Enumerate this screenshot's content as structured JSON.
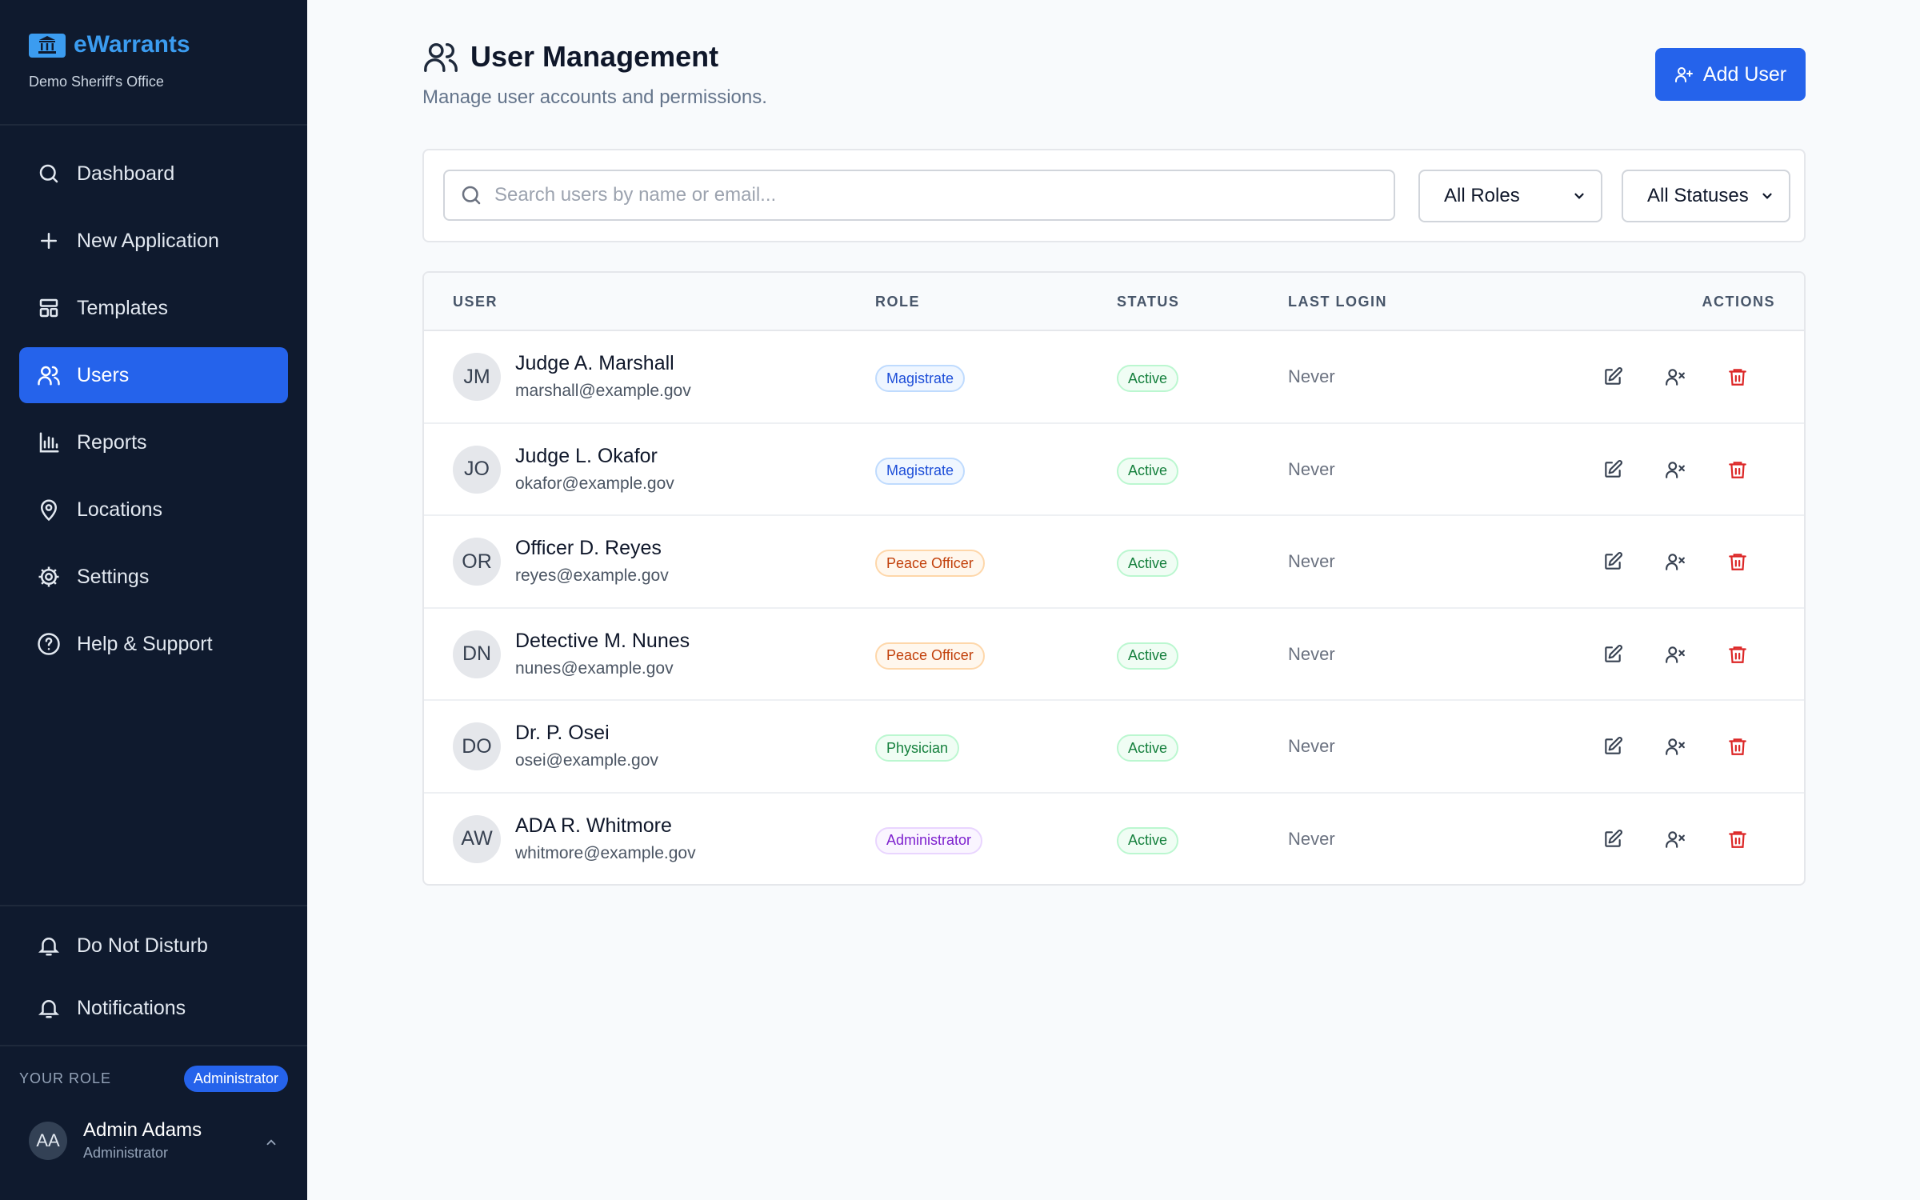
{
  "brand": {
    "name": "eWarrants",
    "org": "Demo Sheriff's Office"
  },
  "nav": [
    {
      "label": "Dashboard",
      "icon": "search-icon"
    },
    {
      "label": "New Application",
      "icon": "plus-icon"
    },
    {
      "label": "Templates",
      "icon": "layout-icon"
    },
    {
      "label": "Users",
      "icon": "users-icon",
      "active": true
    },
    {
      "label": "Reports",
      "icon": "bar-chart-icon"
    },
    {
      "label": "Locations",
      "icon": "map-pin-icon"
    },
    {
      "label": "Settings",
      "icon": "gear-icon"
    },
    {
      "label": "Help & Support",
      "icon": "help-circle-icon"
    }
  ],
  "bottom_nav": [
    {
      "label": "Do Not Disturb",
      "icon": "bell-icon"
    },
    {
      "label": "Notifications",
      "icon": "bell-icon"
    }
  ],
  "your_role": {
    "label": "YOUR ROLE",
    "value": "Administrator"
  },
  "current_user": {
    "initials": "AA",
    "name": "Admin Adams",
    "role": "Administrator"
  },
  "header": {
    "title": "User Management",
    "subtitle": "Manage user accounts and permissions.",
    "add_label": "Add User"
  },
  "filters": {
    "search_placeholder": "Search users by name or email...",
    "role_select": "All Roles",
    "status_select": "All Statuses"
  },
  "table": {
    "columns": {
      "user": "USER",
      "role": "ROLE",
      "status": "STATUS",
      "last_login": "LAST LOGIN",
      "actions": "ACTIONS"
    },
    "rows": [
      {
        "initials": "JM",
        "name": "Judge A. Marshall",
        "email": "marshall@example.gov",
        "role": "Magistrate",
        "status": "Active",
        "last_login": "Never"
      },
      {
        "initials": "JO",
        "name": "Judge L. Okafor",
        "email": "okafor@example.gov",
        "role": "Magistrate",
        "status": "Active",
        "last_login": "Never"
      },
      {
        "initials": "OR",
        "name": "Officer D. Reyes",
        "email": "reyes@example.gov",
        "role": "Peace Officer",
        "status": "Active",
        "last_login": "Never"
      },
      {
        "initials": "DN",
        "name": "Detective M. Nunes",
        "email": "nunes@example.gov",
        "role": "Peace Officer",
        "status": "Active",
        "last_login": "Never"
      },
      {
        "initials": "DO",
        "name": "Dr. P. Osei",
        "email": "osei@example.gov",
        "role": "Physician",
        "status": "Active",
        "last_login": "Never"
      },
      {
        "initials": "AW",
        "name": "ADA R. Whitmore",
        "email": "whitmore@example.gov",
        "role": "Administrator",
        "status": "Active",
        "last_login": "Never"
      }
    ]
  },
  "colors": {
    "sidebar_bg": "#0f1a2e",
    "accent": "#2563eb",
    "brand": "#3b9cf0",
    "role_colors": {
      "Magistrate": {
        "fg": "#1d4ed8",
        "bg": "#eff6ff",
        "border": "#bfdbfe"
      },
      "Peace Officer": {
        "fg": "#c2410c",
        "bg": "#fff7ed",
        "border": "#fed7aa"
      },
      "Physician": {
        "fg": "#15803d",
        "bg": "#f0fdf4",
        "border": "#bbf7d0"
      },
      "Administrator": {
        "fg": "#7e22ce",
        "bg": "#faf5ff",
        "border": "#e9d5ff"
      }
    },
    "status_active": {
      "fg": "#15803d",
      "bg": "#f0fdf4",
      "border": "#bbf7d0"
    },
    "danger": "#dc2626"
  }
}
